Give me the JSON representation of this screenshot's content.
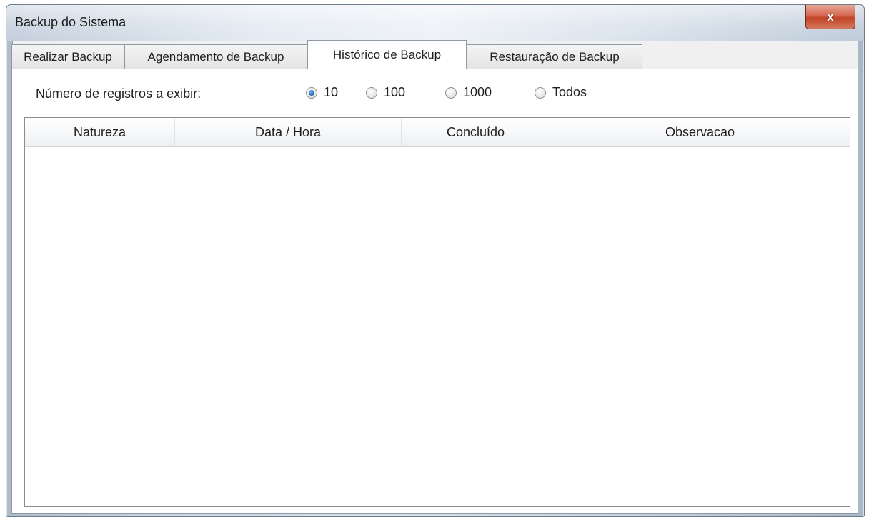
{
  "window": {
    "title": "Backup do Sistema",
    "close_glyph": "x"
  },
  "tabs": [
    {
      "label": "Realizar Backup"
    },
    {
      "label": "Agendamento de Backup"
    },
    {
      "label": "Histórico de Backup",
      "active": true
    },
    {
      "label": "Restauração de Backup"
    }
  ],
  "filter": {
    "label": "Número de registros a exibir:",
    "options": [
      {
        "label": "10",
        "checked": true
      },
      {
        "label": "100",
        "checked": false
      },
      {
        "label": "1000",
        "checked": false
      },
      {
        "label": "Todos",
        "checked": false
      }
    ]
  },
  "table": {
    "columns": [
      "Natureza",
      "Data / Hora",
      "Concluído",
      "Observacao"
    ],
    "rows": []
  },
  "colors": {
    "accent_radio": "#2a6fbf",
    "close_button": "#c24426"
  }
}
